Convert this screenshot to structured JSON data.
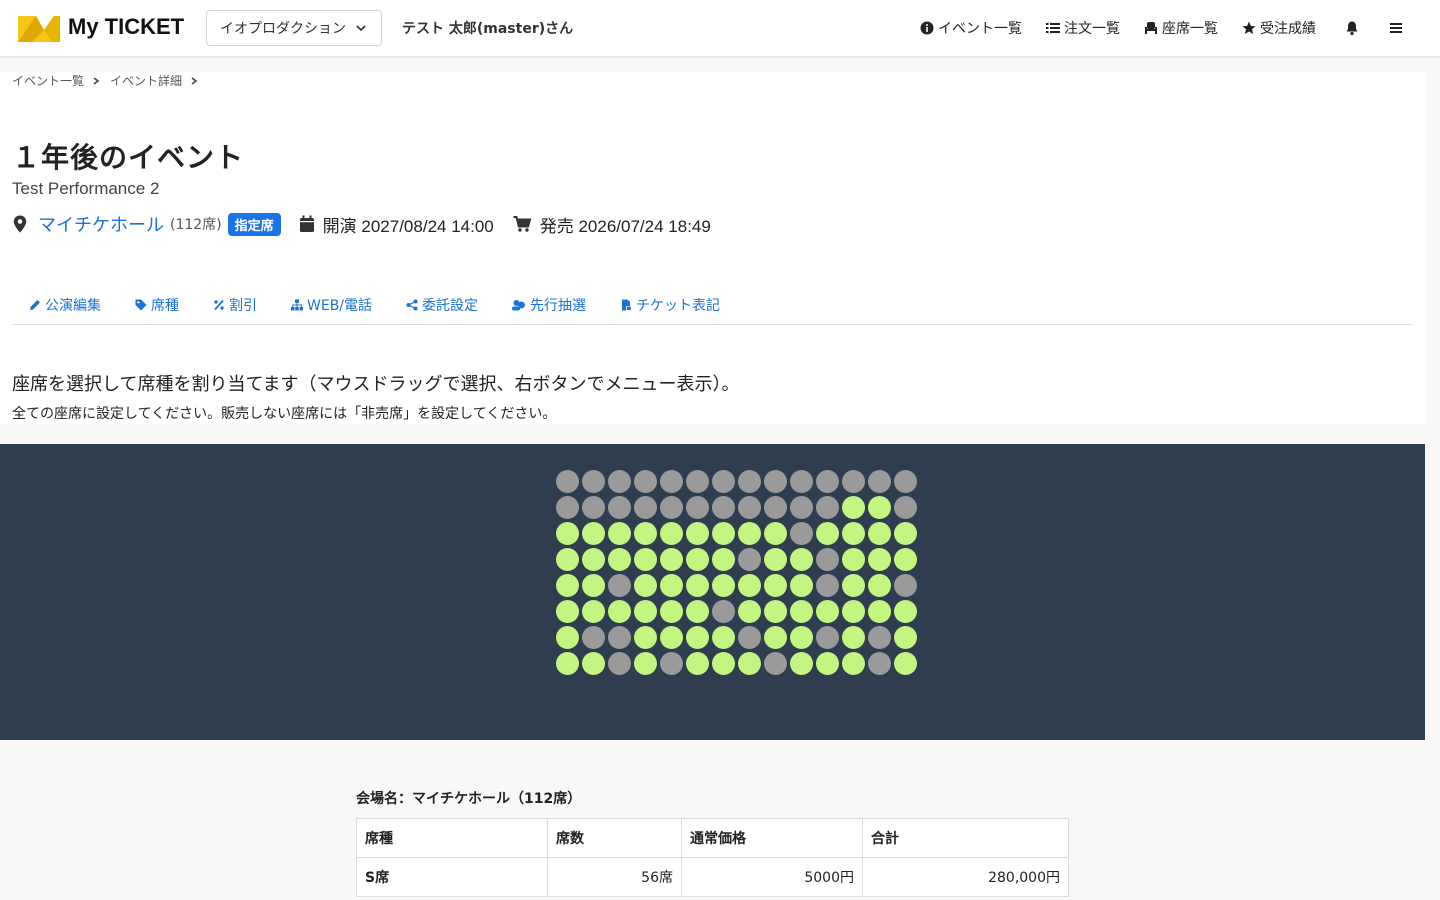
{
  "header": {
    "logo_text": "My TICKET",
    "org_select_value": "イオプロダクション",
    "user_name": "テスト 太郎(master)さん",
    "nav": [
      {
        "label": "イベント一覧",
        "icon": "info-circle-icon"
      },
      {
        "label": "注文一覧",
        "icon": "list-icon"
      },
      {
        "label": "座席一覧",
        "icon": "chair-icon"
      },
      {
        "label": "受注成績",
        "icon": "star-icon"
      }
    ],
    "bell_icon": "bell-icon",
    "menu_icon": "hamburger-icon",
    "colors": {
      "logo_yellow": "#f5c518",
      "logo_dark": "#e0a800"
    }
  },
  "breadcrumb": [
    "イベント一覧",
    "イベント詳細"
  ],
  "event": {
    "title": "１年後のイベント",
    "subtitle": "Test Performance 2",
    "venue": "マイチケホール",
    "seat_count": "(112席)",
    "badge": "指定席",
    "open_label": "開演 2027/08/24 14:00",
    "sale_label": "発売 2026/07/24 18:49"
  },
  "tabs": [
    {
      "label": "公演編集",
      "icon": "pencil-icon"
    },
    {
      "label": "席種",
      "icon": "tag-icon"
    },
    {
      "label": "割引",
      "icon": "percent-icon"
    },
    {
      "label": "WEB/電話",
      "icon": "sitemap-icon"
    },
    {
      "label": "委託設定",
      "icon": "share-icon"
    },
    {
      "label": "先行抽選",
      "icon": "users-icon"
    },
    {
      "label": "チケット表記",
      "icon": "ticket-icon"
    }
  ],
  "instructions": {
    "line1": "座席を選択して席種を割り当てます（マウスドラッグで選択、右ボタンでメニュー表示）。",
    "line2": "全ての座席に設定してください。販売しない座席には「非売席」を設定してください。"
  },
  "seatmap": {
    "colors": {
      "background": "#2e3d4f",
      "assigned": "#c2f680",
      "unassigned": "#9a9a9a"
    },
    "legend_codes": "G = green (assigned), X = gray (unassigned)",
    "rows": [
      "XXXXXXXXXXXXXX",
      "XXXXXXXXXXXGGX",
      "GGGGGGGGGXGGGG",
      "GGGGGGGXGGXGGG",
      "GGXGGGGGGGXGGX",
      "GGGGGGXGGGGGGG",
      "GXXGGGGXGGXGXG",
      "GGXGXGGGXGGGXG"
    ]
  },
  "summary": {
    "title": "会場名：マイチケホール（112席）",
    "headers": [
      "席種",
      "席数",
      "通常価格",
      "合計"
    ],
    "rows": [
      [
        "S席",
        "56席",
        "5000円",
        "280,000円"
      ]
    ]
  }
}
